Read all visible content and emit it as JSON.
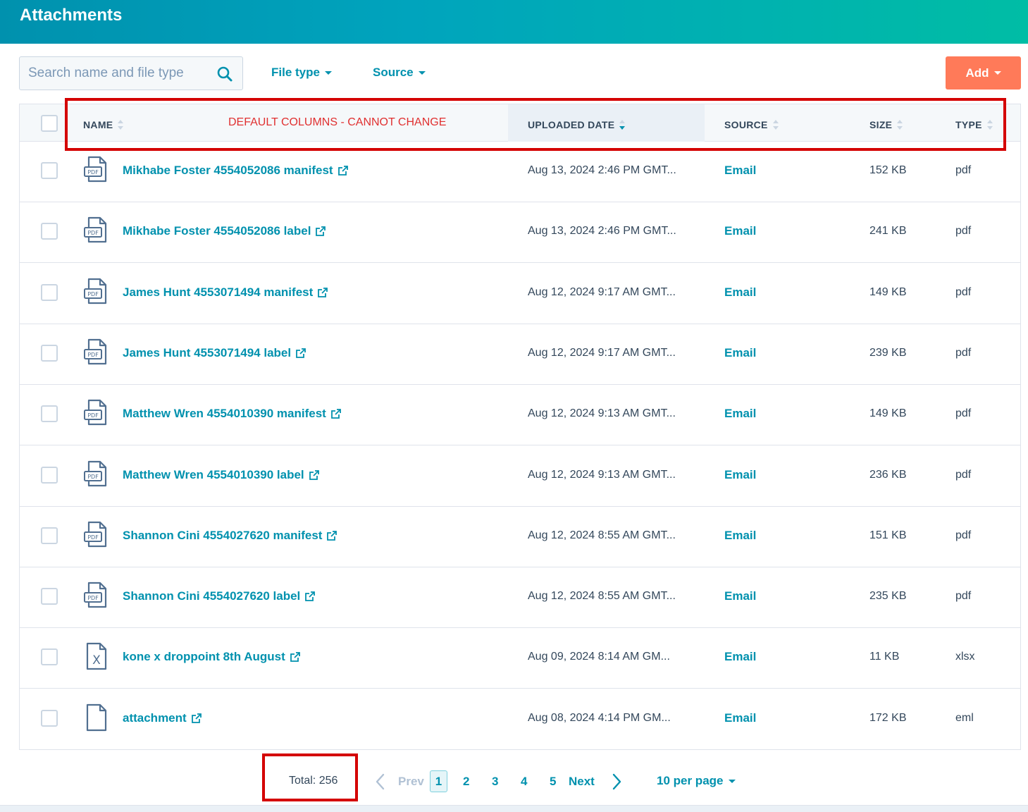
{
  "header": {
    "title": "Attachments"
  },
  "toolbar": {
    "search_placeholder": "Search name and file type",
    "file_type_label": "File type",
    "source_label": "Source",
    "add_label": "Add"
  },
  "table": {
    "columns": {
      "name": "NAME",
      "uploaded_date": "UPLOADED DATE",
      "source": "SOURCE",
      "size": "SIZE",
      "type": "TYPE"
    },
    "sorted_column": "UPLOADED DATE",
    "sort_direction": "descending",
    "annotation": "DEFAULT COLUMNS - CANNOT CHANGE",
    "rows": [
      {
        "icon": "pdf-file-icon",
        "name": "Mikhabe Foster 4554052086 manifest",
        "date": "Aug 13, 2024 2:46 PM GMT...",
        "source": "Email",
        "size": "152 KB",
        "type": "pdf"
      },
      {
        "icon": "pdf-file-icon",
        "name": "Mikhabe Foster 4554052086 label",
        "date": "Aug 13, 2024 2:46 PM GMT...",
        "source": "Email",
        "size": "241 KB",
        "type": "pdf"
      },
      {
        "icon": "pdf-file-icon",
        "name": "James Hunt 4553071494 manifest",
        "date": "Aug 12, 2024 9:17 AM GMT...",
        "source": "Email",
        "size": "149 KB",
        "type": "pdf"
      },
      {
        "icon": "pdf-file-icon",
        "name": "James Hunt 4553071494 label",
        "date": "Aug 12, 2024 9:17 AM GMT...",
        "source": "Email",
        "size": "239 KB",
        "type": "pdf"
      },
      {
        "icon": "pdf-file-icon",
        "name": "Matthew Wren 4554010390 manifest",
        "date": "Aug 12, 2024 9:13 AM GMT...",
        "source": "Email",
        "size": "149 KB",
        "type": "pdf"
      },
      {
        "icon": "pdf-file-icon",
        "name": "Matthew Wren 4554010390 label",
        "date": "Aug 12, 2024 9:13 AM GMT...",
        "source": "Email",
        "size": "236 KB",
        "type": "pdf"
      },
      {
        "icon": "pdf-file-icon",
        "name": "Shannon Cini 4554027620 manifest",
        "date": "Aug 12, 2024 8:55 AM GMT...",
        "source": "Email",
        "size": "151 KB",
        "type": "pdf"
      },
      {
        "icon": "pdf-file-icon",
        "name": "Shannon Cini 4554027620 label",
        "date": "Aug 12, 2024 8:55 AM GMT...",
        "source": "Email",
        "size": "235 KB",
        "type": "pdf"
      },
      {
        "icon": "excel-file-icon",
        "name": "kone x droppoint 8th August",
        "date": "Aug 09, 2024 8:14 AM GM...",
        "source": "Email",
        "size": "11 KB",
        "type": "xlsx"
      },
      {
        "icon": "blank-file-icon",
        "name": "attachment",
        "date": "Aug 08, 2024 4:14 PM GM...",
        "source": "Email",
        "size": "172 KB",
        "type": "eml"
      }
    ]
  },
  "pagination": {
    "total": "Total: 256",
    "prev_label": "Prev",
    "next_label": "Next",
    "pages": [
      "1",
      "2",
      "3",
      "4",
      "5"
    ],
    "current_page": "1",
    "per_page_label": "10 per page"
  },
  "colors": {
    "accent": "#0091ae",
    "add_button": "#ff7a59",
    "header_gradient_start": "#0091ae",
    "header_gradient_end": "#00bda5",
    "annotation_red": "#d40000"
  }
}
